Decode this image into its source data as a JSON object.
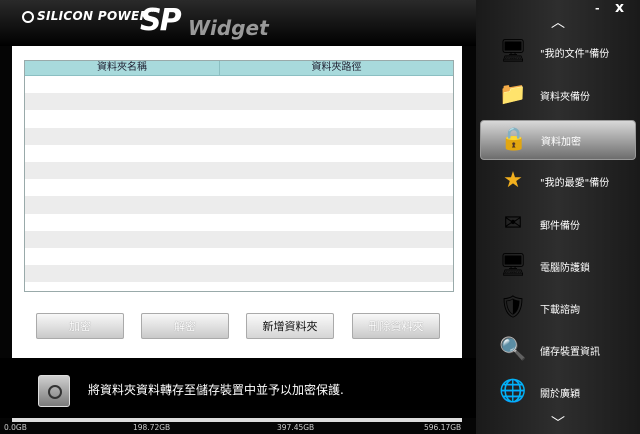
{
  "header": {
    "brand": "SILICON POWER",
    "brand_tm": "™",
    "logo_sp": "SP",
    "logo_widget": "Widget"
  },
  "table": {
    "columns": [
      "資料夾名稱",
      "資料夾路徑"
    ],
    "rows": [
      "",
      "",
      "",
      "",
      "",
      "",
      "",
      "",
      "",
      "",
      "",
      "",
      ""
    ]
  },
  "buttons": {
    "encrypt": "加密",
    "decrypt": "解密",
    "add_folder": "新增資料夾",
    "delete_folder": "刪除資料夾"
  },
  "footer": {
    "description": "將資料夾資料轉存至儲存裝置中並予以加密保護."
  },
  "capacity": {
    "labels": [
      "0.0GB",
      "198.72GB",
      "397.45GB",
      "596.17GB"
    ]
  },
  "sidebar": {
    "minimize": "-",
    "close": "x",
    "scroll_up": "︿",
    "scroll_down": "﹀",
    "items": [
      {
        "label": "\"我的文件\"備份",
        "icon": "monitor-backup-icon",
        "glyph": "🖥"
      },
      {
        "label": "資料夾備份",
        "icon": "folder-backup-icon",
        "glyph": "📁"
      },
      {
        "label": "資料加密",
        "icon": "lock-icon",
        "glyph": "🔒"
      },
      {
        "label": "\"我的最愛\"備份",
        "icon": "star-icon",
        "glyph": "★"
      },
      {
        "label": "郵件備份",
        "icon": "envelope-icon",
        "glyph": "✉"
      },
      {
        "label": "電腦防護鎖",
        "icon": "pc-lock-icon",
        "glyph": "🖥"
      },
      {
        "label": "下載諮詢",
        "icon": "shield-icon",
        "glyph": "🛡"
      },
      {
        "label": "儲存裝置資訊",
        "icon": "magnifier-icon",
        "glyph": "🔍"
      },
      {
        "label": "關於廣穎",
        "icon": "globe-icon",
        "glyph": "🌐"
      }
    ],
    "selected_index": 2
  }
}
